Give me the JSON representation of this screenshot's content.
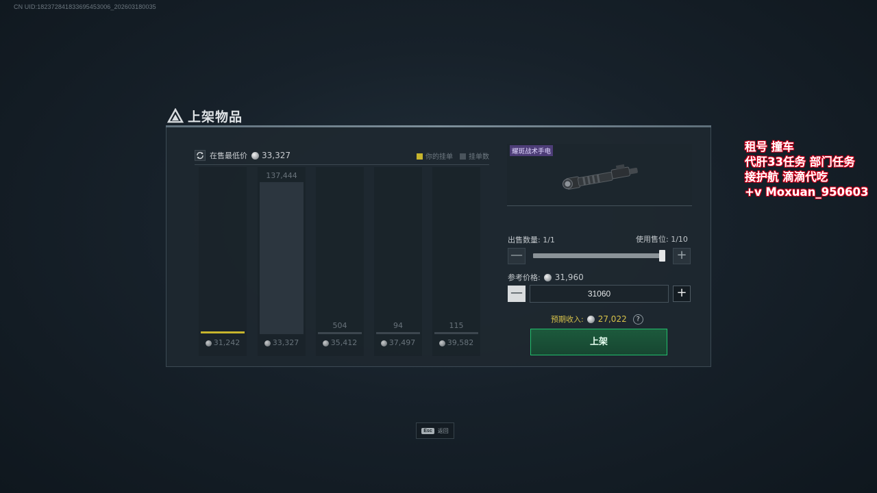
{
  "uid": "CN UID:1823728418336954530​06_202603180035",
  "title": "上架物品",
  "chart_header": {
    "label": "在售最低价",
    "price": "33,327",
    "legend": [
      {
        "label": "你的挂单",
        "color": "#c7b52d"
      },
      {
        "label": "挂单数",
        "color": "#4a545c"
      }
    ]
  },
  "chart_data": {
    "type": "bar",
    "categories": [
      "31,242",
      "33,327",
      "35,412",
      "37,497",
      "39,582"
    ],
    "values": [
      null,
      137444,
      504,
      94,
      115
    ],
    "value_labels": [
      "",
      "137,444",
      "504",
      "94",
      "115"
    ],
    "highlight_index": 0,
    "series": [
      {
        "name": "挂单数",
        "values": [
          null,
          137444,
          504,
          94,
          115
        ]
      }
    ]
  },
  "item": {
    "name": "耀斑战术手电"
  },
  "sell": {
    "qty_label": "出售数量:",
    "qty_value": "1/1",
    "slot_label": "使用售位:",
    "slot_value": "1/10",
    "slider_fraction": 1.0,
    "ref_label": "参考价格:",
    "ref_price": "31,960",
    "price_input": "31060",
    "income_label": "预期收入:",
    "income_value": "27,022",
    "help_symbol": "?",
    "minus_symbol": "—",
    "plus_symbol": "+",
    "list_button": "上架"
  },
  "footer": {
    "esc_key": "Esc",
    "esc_label": "返回"
  },
  "overlay_lines": [
    "租号 撞车",
    "代肝33任务 部门任务",
    "接护航 滴滴代吃",
    "+v Moxuan_950603"
  ]
}
